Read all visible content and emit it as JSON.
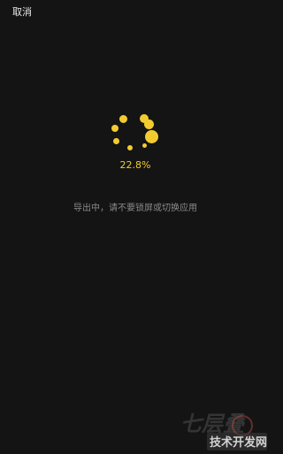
{
  "header": {
    "cancel_label": "取消"
  },
  "export": {
    "progress_percent": 22.8,
    "progress_text": "22.8%",
    "message": "导出中，请不要锁屏或切换应用"
  },
  "colors": {
    "background": "#141414",
    "accent": "#f2cc2e",
    "message": "#8a8a8a"
  },
  "icons": {
    "spinner": "loading-dots-icon"
  },
  "watermark": {
    "brand": "七层叠",
    "site": "技术开发网"
  }
}
